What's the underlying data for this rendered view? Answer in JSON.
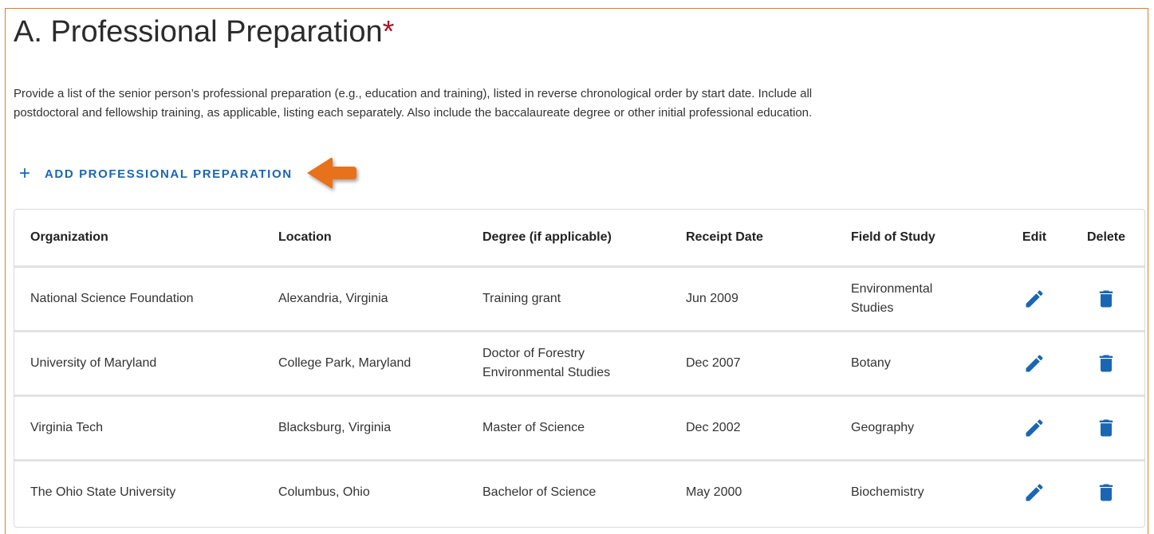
{
  "section": {
    "title": "A. Professional Preparation",
    "required_marker": "*",
    "description": "Provide a list of the senior person’s professional preparation (e.g., education and training), listed in reverse chronological order by start date. Include all postdoctoral and fellowship training, as applicable, listing each separately. Also include the baccalaureate degree or other initial professional education.",
    "add_button_icon": "+",
    "add_button_label": "ADD PROFESSIONAL PREPARATION"
  },
  "colors": {
    "accent_blue": "#1a66b3",
    "frame_orange": "#e07b22",
    "required_red": "#a3182b"
  },
  "icons": {
    "add": "plus-icon",
    "edit": "pencil-icon",
    "delete": "trash-icon",
    "callout": "arrow-icon"
  },
  "table": {
    "headers": [
      "Organization",
      "Location",
      "Degree (if applicable)",
      "Receipt Date",
      "Field of Study",
      "Edit",
      "Delete"
    ],
    "rows": [
      {
        "organization": "National Science Foundation",
        "location": "Alexandria, Virginia",
        "degree": "Training grant",
        "receipt_date": "Jun 2009",
        "field": "Environmental Studies"
      },
      {
        "organization": "University of Maryland",
        "location": "College Park, Maryland",
        "degree": "Doctor of Forestry Environmental Studies",
        "receipt_date": "Dec 2007",
        "field": "Botany"
      },
      {
        "organization": "Virginia Tech",
        "location": "Blacksburg, Virginia",
        "degree": "Master of Science",
        "receipt_date": "Dec 2002",
        "field": "Geography"
      },
      {
        "organization": "The Ohio State University",
        "location": "Columbus, Ohio",
        "degree": "Bachelor of Science",
        "receipt_date": "May 2000",
        "field": "Biochemistry"
      }
    ]
  }
}
